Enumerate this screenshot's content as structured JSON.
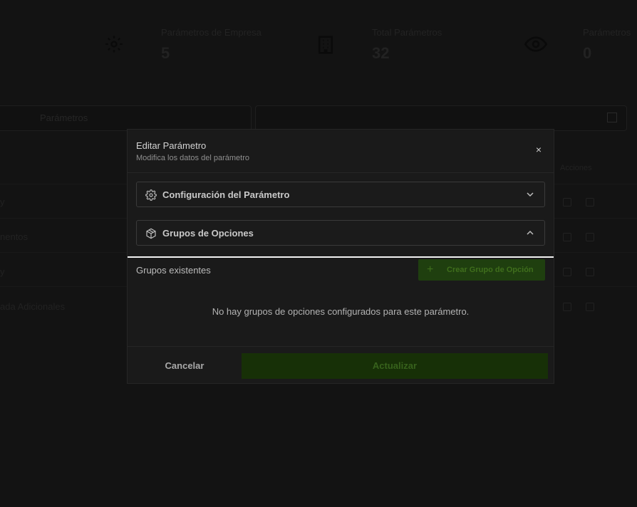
{
  "background": {
    "stats": [
      {
        "label": "",
        "value": "",
        "icon": "gear-icon"
      },
      {
        "label": "Parámetros de Empresa",
        "value": "5",
        "icon": "building-icon"
      },
      {
        "label": "Total Parámetros",
        "value": "32",
        "icon": "eye-icon"
      },
      {
        "label": "Parámetros",
        "value": "0"
      }
    ],
    "search_placeholder": "Parámetros",
    "column_header": "Acciones",
    "rows": [
      "y",
      "nentos",
      "y",
      "ada Adicionales"
    ]
  },
  "modal": {
    "title": "Editar Parámetro",
    "subtitle": "Modifica los datos del parámetro",
    "close_icon": "×",
    "config_section": {
      "label": "Configuración del Parámetro",
      "icon": "gear-icon",
      "state": "collapsed"
    },
    "groups_section": {
      "label": "Grupos de Opciones",
      "icon": "package-icon",
      "state": "expanded"
    },
    "existing_groups_title": "Grupos existentes",
    "create_button": {
      "icon": "+",
      "label": "Crear Grupo de Opción"
    },
    "empty_message": "No hay grupos de opciones configurados para este parámetro.",
    "cancel_label": "Cancelar",
    "update_label": "Actualizar"
  },
  "colors": {
    "overlay": "#131313",
    "modal_bg": "#1a1a1a",
    "accent_green": "#1f3f0f",
    "update_green": "#173007",
    "focus_line": "#f2f2f2"
  }
}
